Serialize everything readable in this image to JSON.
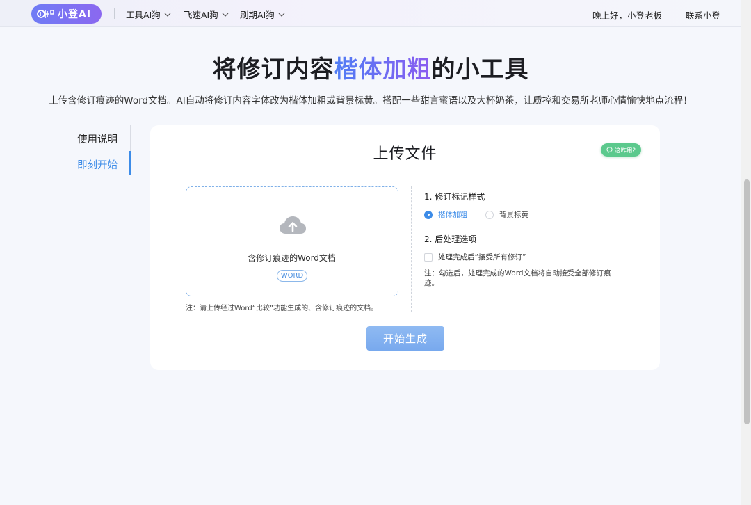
{
  "nav": {
    "logo_text": "小登AI",
    "menu": [
      {
        "label": "工具AI狗"
      },
      {
        "label": "飞速AI狗"
      },
      {
        "label": "刷期AI狗"
      }
    ],
    "greeting": "晚上好，小登老板",
    "contact": "联系小登"
  },
  "hero": {
    "title_pre": "将修订内容",
    "title_highlight": "楷体加粗",
    "title_post": "的小工具",
    "subtitle": "上传含修订痕迹的Word文档。AI自动将修订内容字体改为楷体加粗或背景标黄。搭配一些甜言蜜语以及大杯奶茶，让质控和交易所老师心情愉快地点流程！"
  },
  "side_tabs": [
    {
      "label": "使用说明",
      "active": false
    },
    {
      "label": "即刻开始",
      "active": true
    }
  ],
  "card": {
    "title": "上传文件",
    "help_badge": "这咋用?",
    "upload": {
      "text": "含修订痕迹的Word文档",
      "tag": "WORD",
      "note": "注：请上传经过Word“比较”功能生成的、含修订痕迹的文档。"
    },
    "options": {
      "section1_title": "1. 修订标记样式",
      "radio_options": [
        {
          "label": "楷体加粗",
          "selected": true
        },
        {
          "label": "背景标黄",
          "selected": false
        }
      ],
      "section2_title": "2. 后处理选项",
      "checkbox_label": "处理完成后“接受所有修订”",
      "checkbox_checked": false,
      "note": "注：勾选后，处理完成的Word文档将自动接受全部修订痕迹。"
    },
    "submit_label": "开始生成"
  },
  "colors": {
    "accent": "#3d8ce8",
    "logo_gradient_start": "#6f7cf5",
    "logo_gradient_end": "#8b68f0",
    "help_badge": "#5cc98d",
    "button": "#83b2f0"
  },
  "icons": {
    "logo": "logo-mark-icon",
    "menu_caret": "chevron-down-icon",
    "upload": "cloud-upload-icon",
    "help": "chat-bubble-icon"
  }
}
